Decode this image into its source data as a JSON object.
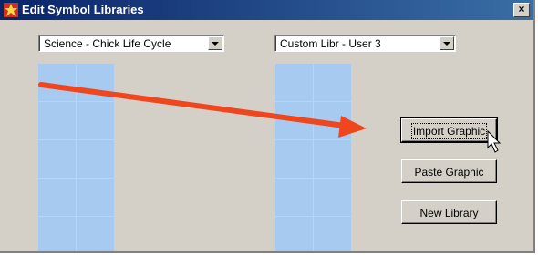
{
  "window": {
    "title": "Edit Symbol Libraries",
    "close_label": "×"
  },
  "left_library": {
    "selected": "Science - Chick Life Cycle"
  },
  "right_library": {
    "selected": "Custom Libr - User 3"
  },
  "buttons": {
    "import_label": "Import Graphic",
    "paste_label": "Paste Graphic",
    "new_library_label": "New Library"
  },
  "colors": {
    "titlebar": "#0a246a",
    "dialog_bg": "#d4d0c8",
    "cell": "#a6caf0",
    "annotation_arrow": "#f0461e"
  },
  "icons": {
    "app": "app-icon",
    "cursor": "arrow-cursor-icon",
    "annotation": "red-arrow-annotation"
  }
}
